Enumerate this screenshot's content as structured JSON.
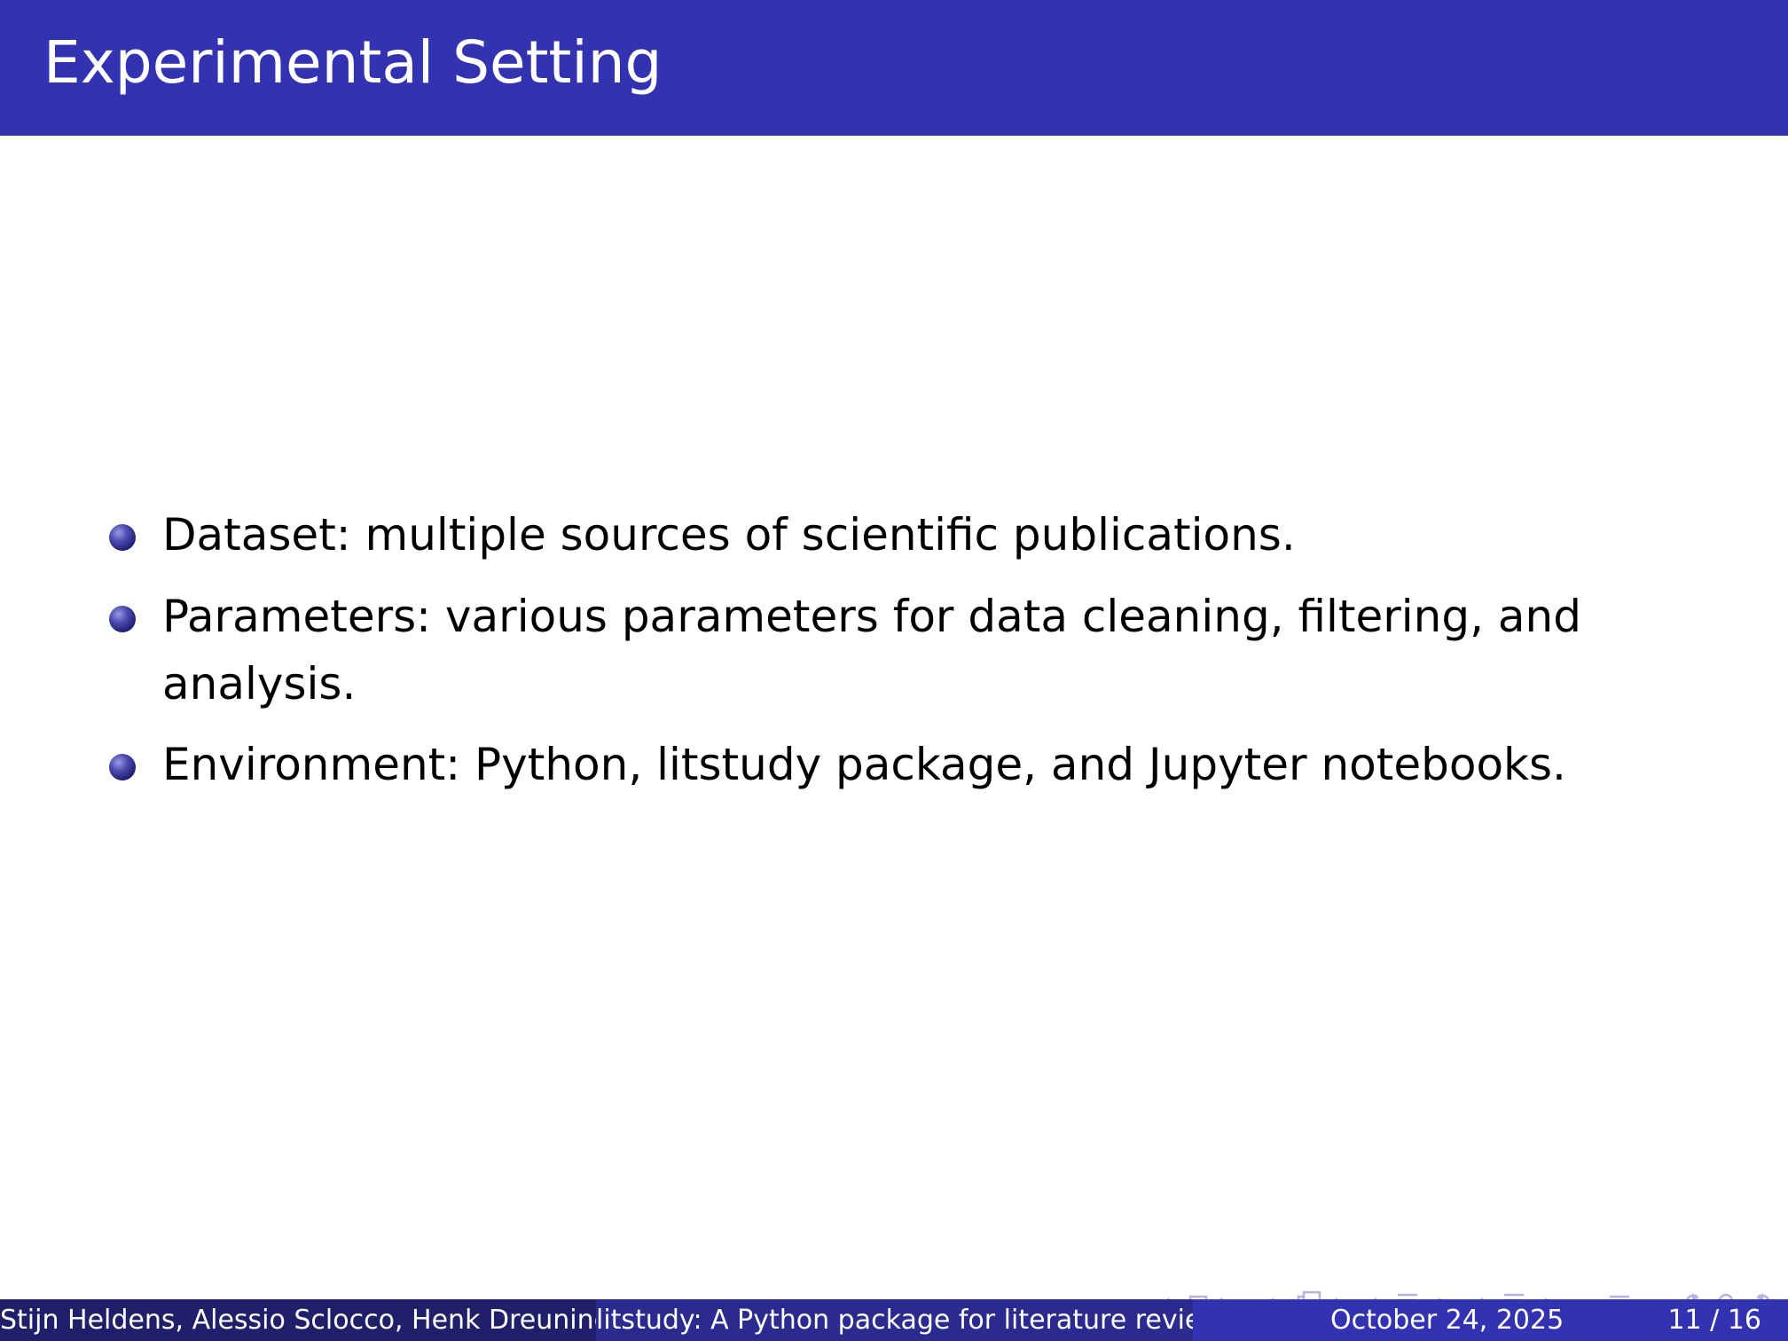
{
  "slide": {
    "title": "Experimental Setting",
    "items": [
      "Dataset: multiple sources of scientific publications.",
      "Parameters: various parameters for data cleaning, filtering, and analysis.",
      "Environment: Python, litstudy package, and Jupyter notebooks."
    ]
  },
  "footer": {
    "authors": "Stijn Heldens, Alessio Sclocco, Henk Dreuning",
    "short_title": "litstudy: A Python package for literature revie",
    "date": "October 24, 2025",
    "page": "11 / 16"
  },
  "colors": {
    "title_bar": "#3333b2",
    "footer_left": "#1f1f6a",
    "footer_middle": "#2a2a8f",
    "footer_right": "#3333b2",
    "nav_symbols": "#b3b3de"
  },
  "navigation": {
    "icons": [
      "frame-nav-icon",
      "subsection-nav-icon",
      "section-nav-icon",
      "document-nav-icon",
      "appendix-nav-icon",
      "search-icon",
      "undo-redo-icon"
    ]
  }
}
